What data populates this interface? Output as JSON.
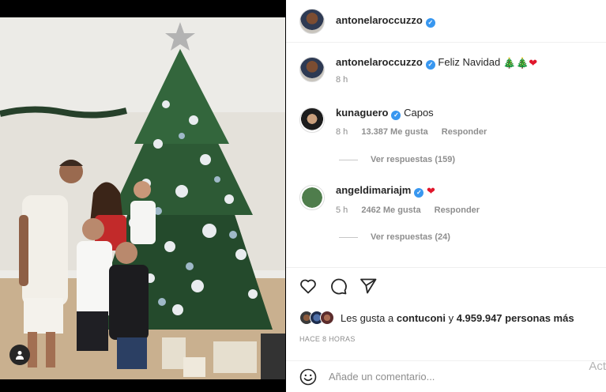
{
  "post": {
    "author": "antonelaroccuzzo",
    "comments": [
      {
        "username": "antonelaroccuzzo",
        "text": "Feliz Navidad",
        "emoji": [
          "🎄",
          "🎄",
          "❤"
        ],
        "time": "8 h"
      },
      {
        "username": "kunaguero",
        "text": "Capos",
        "time": "8 h",
        "likes": "13.387 Me gusta",
        "reply": "Responder",
        "view_replies": "Ver respuestas (159)"
      },
      {
        "username": "angeldimariajm",
        "text": "",
        "emoji": [
          "❤"
        ],
        "time": "5 h",
        "likes": "2462 Me gusta",
        "reply": "Responder",
        "view_replies": "Ver respuestas (24)"
      }
    ],
    "likes_prefix": "Les gusta a",
    "likes_user": "contuconi",
    "likes_connector": "y",
    "likes_count": "4.959.947 personas más",
    "posted_ago": "HACE 8 HORAS",
    "add_comment_placeholder": "Añade un comentario...",
    "watermark": "Act"
  },
  "icons": {
    "like": "heart-icon",
    "comment": "comment-icon",
    "share": "send-icon",
    "emoji": "smiley-icon",
    "tag": "user-tag-icon"
  },
  "colors": {
    "verified": "#3897f0",
    "text": "#262626",
    "muted": "#8e8e8e"
  }
}
